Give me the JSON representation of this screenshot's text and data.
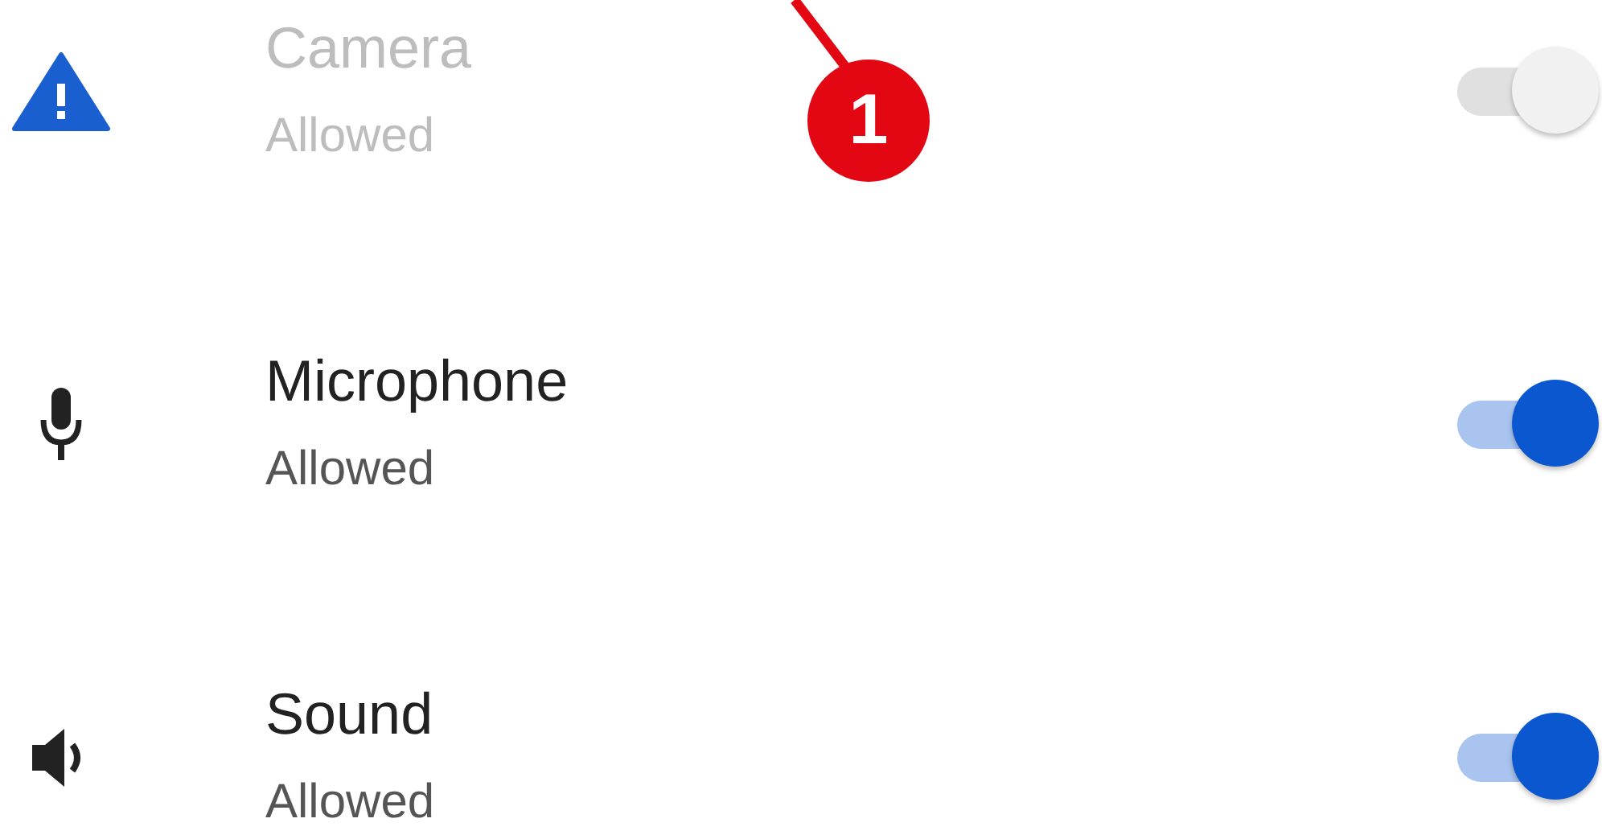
{
  "permissions": [
    {
      "title": "Camera",
      "status": "Allowed",
      "disabled": true,
      "on": true
    },
    {
      "title": "Microphone",
      "status": "Allowed",
      "disabled": false,
      "on": true
    },
    {
      "title": "Sound",
      "status": "Allowed",
      "disabled": false,
      "on": true
    }
  ],
  "annotation": {
    "label": "1"
  }
}
